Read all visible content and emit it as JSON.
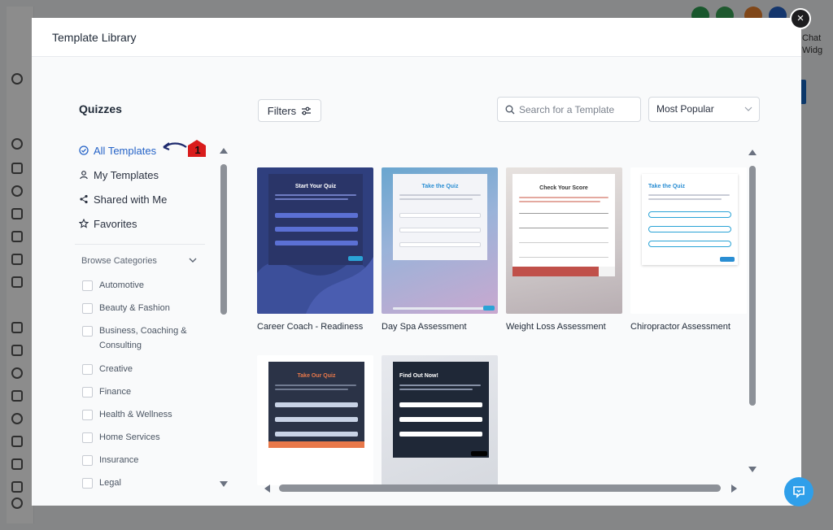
{
  "modal": {
    "title": "Template Library",
    "close_icon": "×"
  },
  "sidebar": {
    "title": "Quizzes",
    "nav": [
      {
        "label": "All Templates",
        "icon": "check-circle-icon",
        "active": true
      },
      {
        "label": "My Templates",
        "icon": "user-icon"
      },
      {
        "label": "Shared with Me",
        "icon": "share-icon"
      },
      {
        "label": "Favorites",
        "icon": "star-icon"
      }
    ],
    "annotation_number": "1",
    "browse_label": "Browse Categories",
    "categories": [
      "Automotive",
      "Beauty & Fashion",
      "Business, Coaching & Consulting",
      "Creative",
      "Finance",
      "Health & Wellness",
      "Home Services",
      "Insurance",
      "Legal"
    ]
  },
  "toolbar": {
    "filters_label": "Filters",
    "search_placeholder": "Search for a Template",
    "sort_value": "Most Popular"
  },
  "templates": [
    {
      "name": "Career Coach - Readiness",
      "heading": "Start Your Quiz"
    },
    {
      "name": "Day Spa Assessment",
      "heading": "Take the Quiz"
    },
    {
      "name": "Weight Loss Assessment",
      "heading": "Check Your Score"
    },
    {
      "name": "Chiropractor Assessment",
      "heading": "Take the Quiz"
    },
    {
      "name": "",
      "heading": "Take Our Quiz"
    },
    {
      "name": "",
      "heading": "Find Out Now!"
    }
  ],
  "background": {
    "right_text_1": "Chat",
    "right_text_2": "Widg"
  },
  "colors": {
    "accent": "#2563c7",
    "dark_navy": "#2c3a6e",
    "teal": "#2aa3d6",
    "orange": "#e8784a"
  }
}
